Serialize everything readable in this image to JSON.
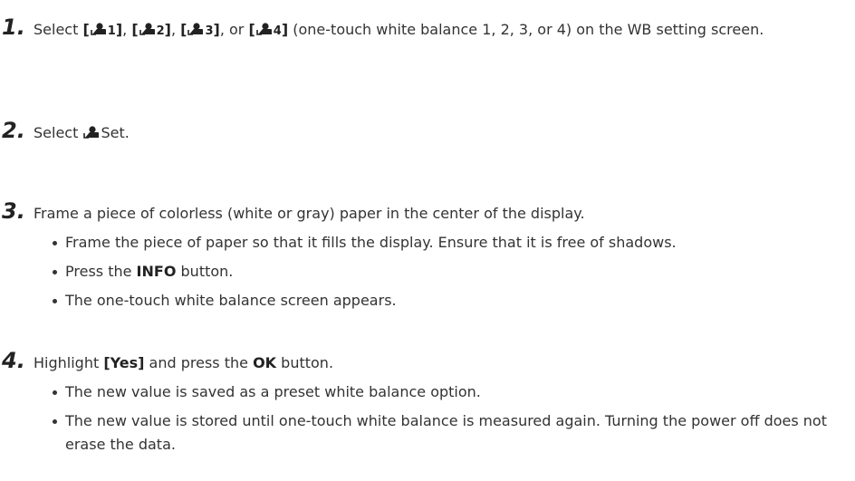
{
  "steps": [
    {
      "number": "1.",
      "text_select": "Select",
      "options": [
        {
          "open": "[",
          "num": "1",
          "close": "]"
        },
        {
          "open": "[",
          "num": "2",
          "close": "]"
        },
        {
          "open": "[",
          "num": "3",
          "close": "]"
        },
        {
          "open": "[",
          "num": "4",
          "close": "]"
        }
      ],
      "sep1": ",",
      "sep2": ",",
      "sep3": ", or",
      "text_rest": "(one-touch white balance 1, 2, 3, or 4) on the WB setting screen."
    },
    {
      "number": "2.",
      "text_select": "Select",
      "text_set": "Set."
    },
    {
      "number": "3.",
      "text": "Frame a piece of colorless (white or gray) paper in the center of the display.",
      "bullets": [
        "Frame the piece of paper so that it fills the display. Ensure that it is free of shadows.",
        {
          "pre": "Press the",
          "bold": "INFO",
          "post": "button."
        },
        "The one-touch white balance screen appears."
      ]
    },
    {
      "number": "4.",
      "pre": "Highlight",
      "bold1": "[Yes]",
      "mid": "and press the",
      "bold2": "OK",
      "post": "button.",
      "bullets": [
        "The new value is saved as a preset white balance option.",
        "The new value is stored until one-touch white balance is measured again. Turning the power off does not erase the data."
      ]
    }
  ],
  "icon": "one-touch-wb-icon"
}
